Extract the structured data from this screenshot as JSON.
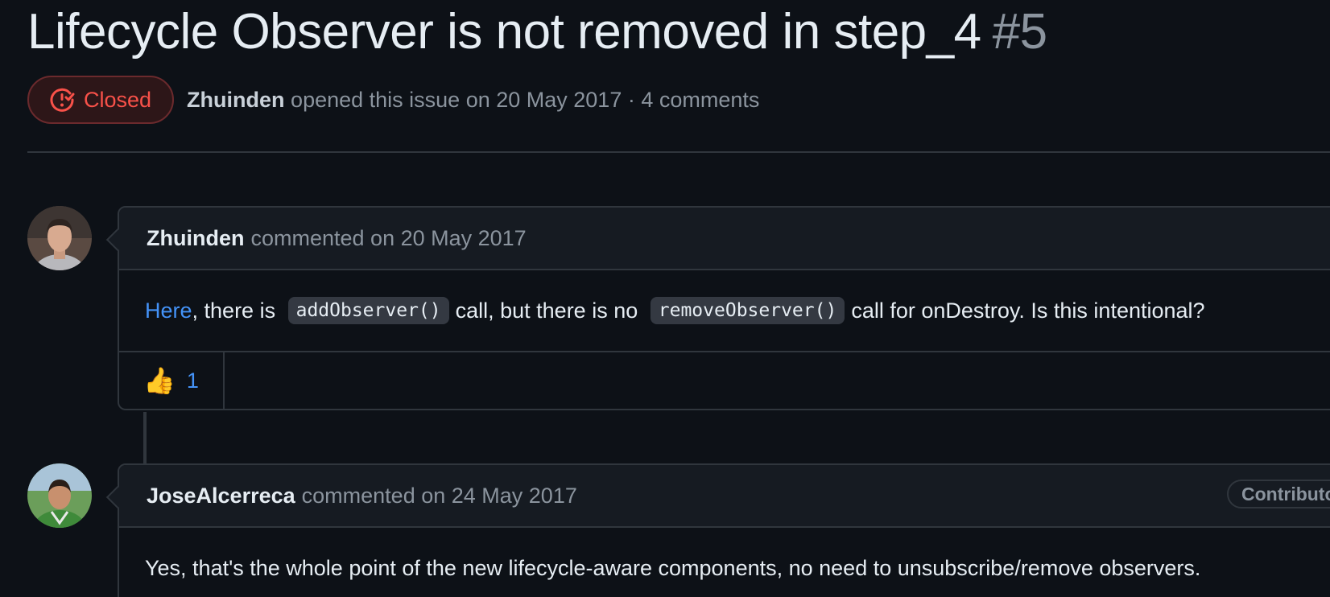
{
  "issue": {
    "title": "Lifecycle Observer is not removed in step_4",
    "number": "#5",
    "state": "Closed",
    "author": "Zhuinden",
    "opened_text": "opened this issue on 20 May 2017 · 4 comments"
  },
  "comments": [
    {
      "author": "Zhuinden",
      "date_text": "commented on 20 May 2017",
      "body": {
        "link_text": "Here",
        "text1": ", there is",
        "code1": "addObserver()",
        "text2": "call, but there is no",
        "code2": "removeObserver()",
        "text3": "call for onDestroy. Is this intentional?"
      },
      "reactions": [
        {
          "emoji": "👍",
          "count": "1"
        }
      ]
    },
    {
      "author": "JoseAlcerreca",
      "date_text": "commented on 24 May 2017",
      "role_badge": "Contributor",
      "body": "Yes, that's the whole point of the new lifecycle-aware components, no need to unsubscribe/remove observers."
    }
  ],
  "colors": {
    "background": "#0d1117",
    "closed": "#f85149",
    "link": "#4493f8",
    "border": "#30363d"
  },
  "icons": [
    "issue-closed-icon",
    "thumbs-up-icon"
  ]
}
